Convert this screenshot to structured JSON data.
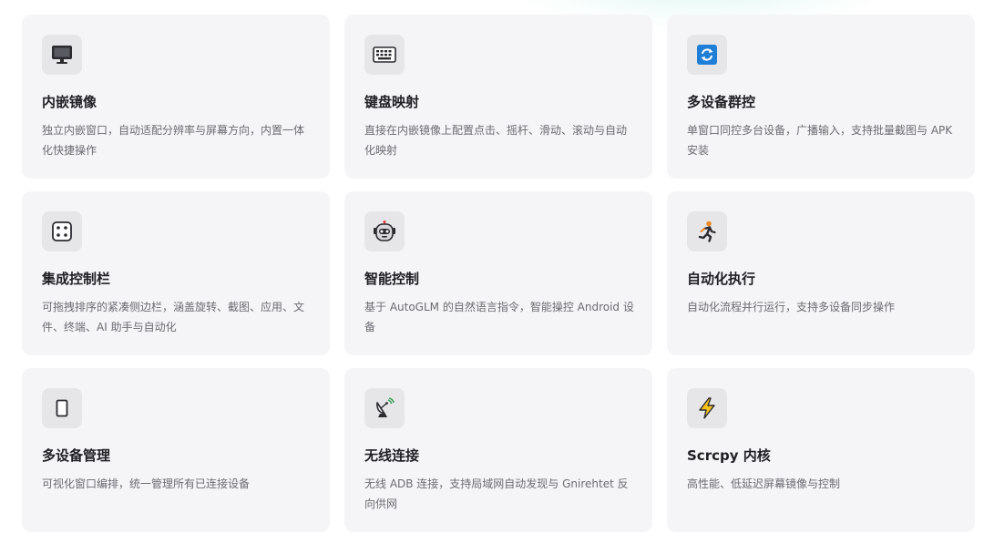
{
  "features": [
    {
      "icon": "monitor-icon",
      "title": "内嵌镜像",
      "desc": "独立内嵌窗口，自动适配分辨率与屏幕方向，内置一体化快捷操作"
    },
    {
      "icon": "keyboard-icon",
      "title": "键盘映射",
      "desc": "直接在内嵌镜像上配置点击、摇杆、滑动、滚动与自动化映射"
    },
    {
      "icon": "sync-icon",
      "title": "多设备群控",
      "desc": "单窗口同控多台设备，广播输入，支持批量截图与 APK 安装"
    },
    {
      "icon": "dice-icon",
      "title": "集成控制栏",
      "desc": "可拖拽排序的紧凑侧边栏，涵盖旋转、截图、应用、文件、终端、AI 助手与自动化"
    },
    {
      "icon": "robot-icon",
      "title": "智能控制",
      "desc": "基于 AutoGLM 的自然语言指令，智能操控 Android 设备"
    },
    {
      "icon": "runner-icon",
      "title": "自动化执行",
      "desc": "自动化流程并行运行，支持多设备同步操作"
    },
    {
      "icon": "phone-icon",
      "title": "多设备管理",
      "desc": "可视化窗口编排，统一管理所有已连接设备"
    },
    {
      "icon": "satellite-dish-icon",
      "title": "无线连接",
      "desc": "无线 ADB 连接，支持局域网自动发现与 Gnirehtet 反向供网"
    },
    {
      "icon": "lightning-icon",
      "title": "Scrcpy 内核",
      "desc": "高性能、低延迟屏幕镜像与控制"
    }
  ],
  "colors": {
    "card_bg": "#f5f5f7",
    "icon_bg": "#e6e6e9",
    "title": "#1f1f24",
    "desc": "#6b6b73",
    "sync_blue": "#1f7fd6",
    "lightning_yellow": "#f7c21b",
    "runner_orange": "#f08a24"
  }
}
